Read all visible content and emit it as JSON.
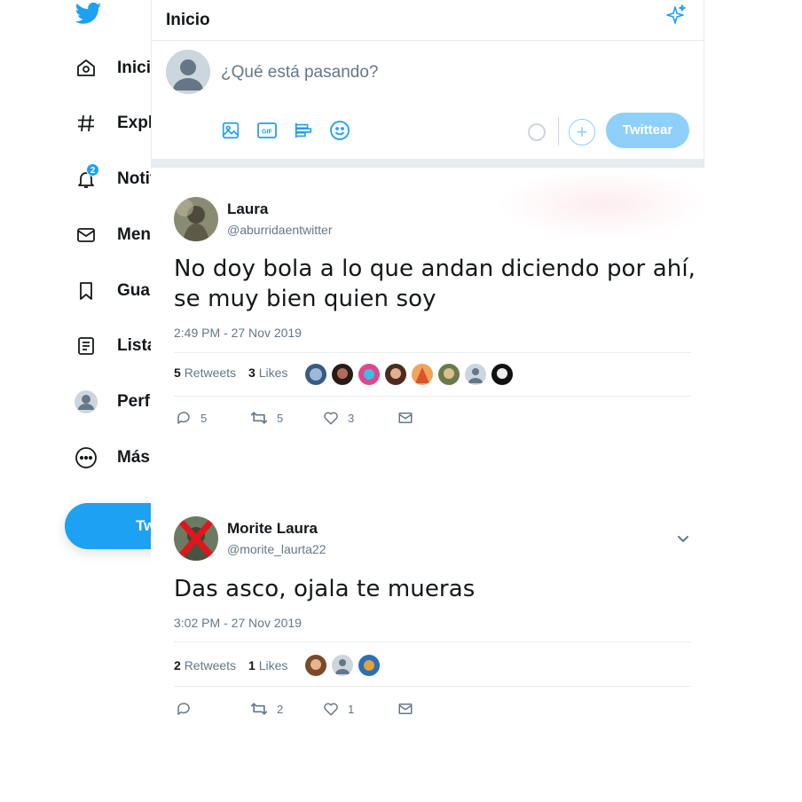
{
  "sidebar": {
    "logo_icon": "twitter-bird-icon",
    "items": [
      {
        "label": "Inicio",
        "icon": "home-icon"
      },
      {
        "label": "Explorar",
        "icon": "hashtag-icon"
      },
      {
        "label": "Notificaciones",
        "icon": "bell-icon",
        "badge": "2"
      },
      {
        "label": "Mensajes",
        "icon": "envelope-icon"
      },
      {
        "label": "Guardados",
        "icon": "bookmark-icon"
      },
      {
        "label": "Listas",
        "icon": "list-icon"
      },
      {
        "label": "Perfil",
        "icon": "profile-icon"
      },
      {
        "label": "Más opciones",
        "icon": "more-circle-icon"
      }
    ],
    "tweet_button": "Twittear"
  },
  "header": {
    "title": "Inicio",
    "icon": "sparkle-icon"
  },
  "composer": {
    "placeholder": "¿Qué está pasando?",
    "tools": [
      "image-icon",
      "gif-icon",
      "poll-icon",
      "emoji-icon"
    ],
    "submit_label": "Twittear",
    "add_label": "+"
  },
  "tweets": [
    {
      "name": "Laura",
      "handle": "@aburridaentwitter",
      "text_line1": "No doy bola a lo que andan diciendo por ahí,",
      "text_line2": "se muy bien quien soy",
      "time": "2:49 PM - 27 Nov 2019",
      "retweets_count": "5",
      "retweets_label": "Retweets",
      "likes_count": "3",
      "likes_label": "Likes",
      "liker_count": 8,
      "replies": "5",
      "retweets": "5",
      "likes": "3"
    },
    {
      "name": "Morite Laura",
      "handle": "@morite_laurta22",
      "text_line1": "Das asco, ojala te mueras",
      "time": "3:02 PM - 27 Nov 2019",
      "retweets_count": "2",
      "retweets_label": "Retweets",
      "likes_count": "1",
      "likes_label": "Likes",
      "liker_count": 3,
      "replies": "",
      "retweets": "2",
      "likes": "1"
    }
  ],
  "colors": {
    "accent": "#1da1f2",
    "accent_light": "#8ed0f9",
    "text": "#14171a",
    "muted": "#657786",
    "border": "#e6ecf0"
  }
}
